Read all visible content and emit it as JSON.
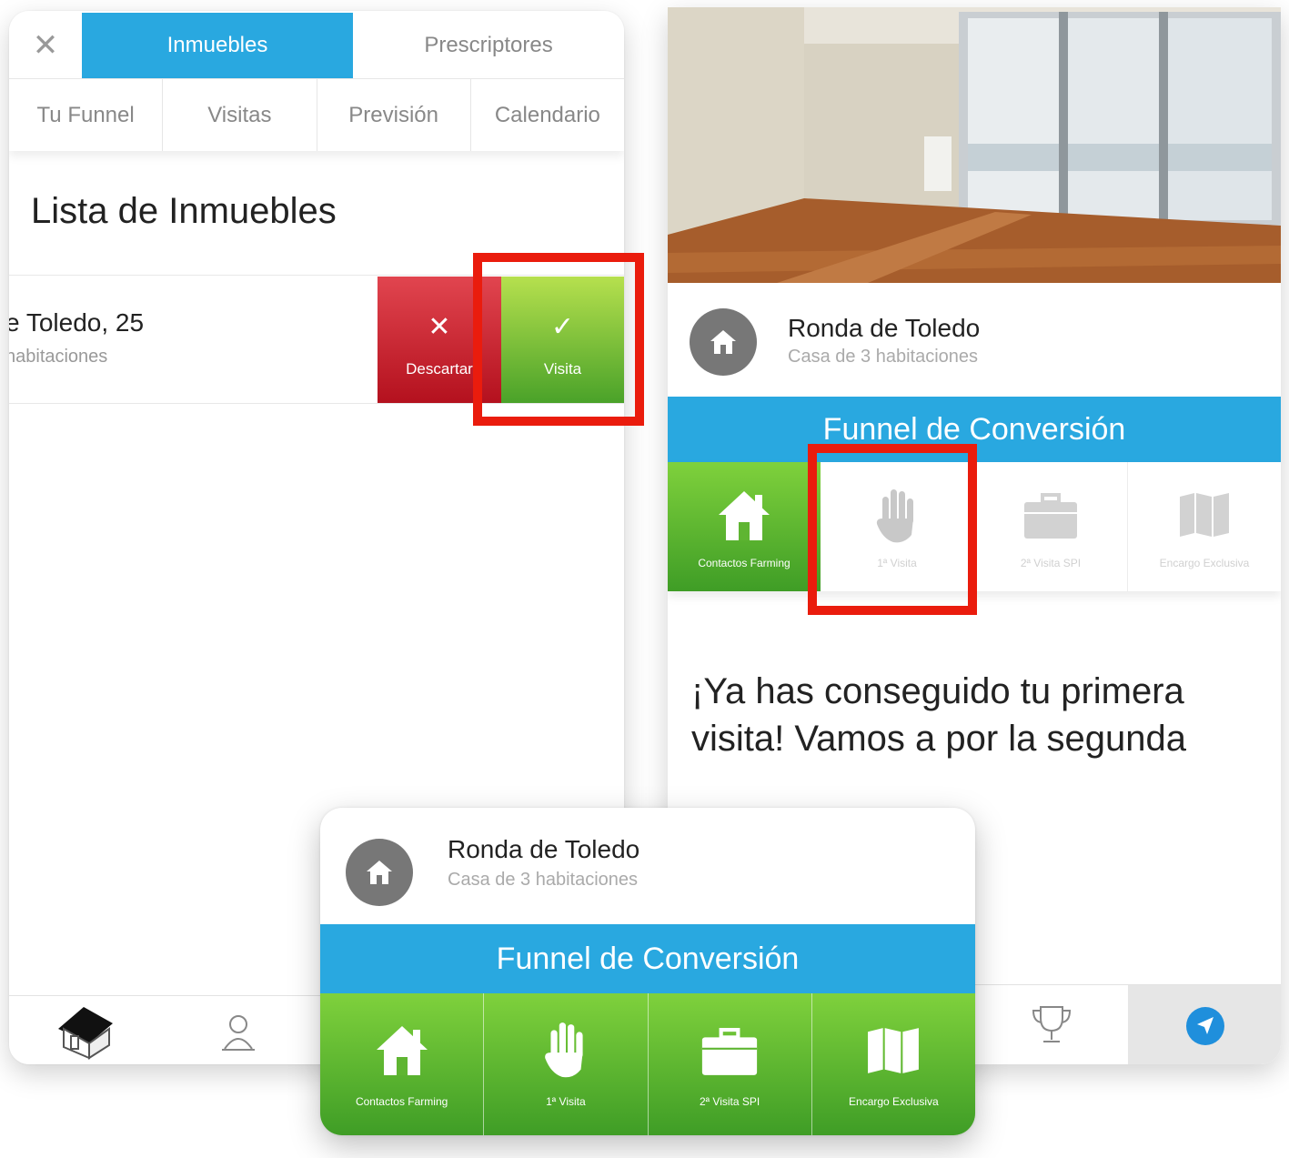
{
  "left_panel": {
    "close_icon": "✕",
    "top_tabs": {
      "active": "Inmuebles",
      "inactive": "Prescriptores"
    },
    "sub_tabs": [
      "Tu Funnel",
      "Visitas",
      "Previsión",
      "Calendario"
    ],
    "list_title": "Lista de Inmuebles",
    "row": {
      "title": "e Toledo, 25",
      "subtitle": "habitaciones",
      "discard_icon": "✕",
      "discard_label": "Descartar",
      "visit_icon": "✓",
      "visit_label": "Visita"
    },
    "bottom_nav": [
      "house-icon",
      "person-icon"
    ]
  },
  "right_panel": {
    "property": {
      "name": "Ronda de Toledo",
      "subtitle": "Casa de 3 habitaciones"
    },
    "funnel_title": "Funnel de Conversión",
    "steps": [
      {
        "label": "Contactos Farming",
        "icon": "house-icon",
        "active": true
      },
      {
        "label": "1ª Visita",
        "icon": "hand-icon",
        "active": false
      },
      {
        "label": "2ª Visita SPI",
        "icon": "briefcase-icon",
        "active": false
      },
      {
        "label": "Encargo Exclusiva",
        "icon": "map-icon",
        "active": false
      }
    ],
    "message": "¡Ya has conseguido tu primera visita! Vamos a por la segunda",
    "bottom_nav": [
      "trophy-icon",
      "navigation-icon"
    ]
  },
  "overlay": {
    "property": {
      "name": "Ronda de Toledo",
      "subtitle": "Casa de 3 habitaciones"
    },
    "funnel_title": "Funnel de Conversión",
    "steps": [
      {
        "label": "Contactos Farming",
        "icon": "house-icon",
        "active": true
      },
      {
        "label": "1ª Visita",
        "icon": "hand-icon",
        "active": true
      },
      {
        "label": "2ª Visita SPI",
        "icon": "briefcase-icon",
        "active": true
      },
      {
        "label": "Encargo Exclusiva",
        "icon": "map-icon",
        "active": true
      }
    ]
  },
  "colors": {
    "blue_accent": "#29a8e0",
    "green_active": "#4aa229",
    "red_discard": "#c41e2a",
    "highlight_red": "#ea1c0d"
  }
}
